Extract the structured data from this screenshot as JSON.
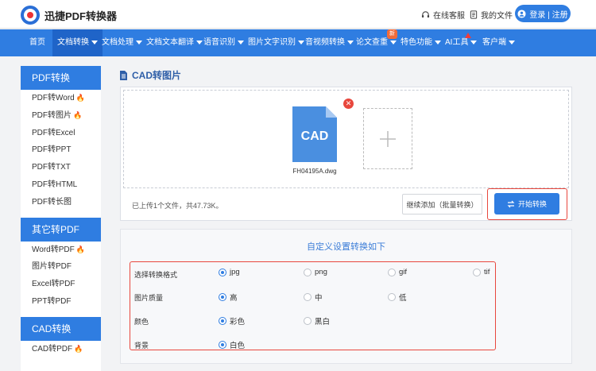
{
  "header": {
    "app_name": "迅捷PDF转换器",
    "support_label": "在线客服",
    "my_files_label": "我的文件",
    "login_label": "登录 | 注册"
  },
  "nav": {
    "items": [
      {
        "label": "首页"
      },
      {
        "label": "文档转换"
      },
      {
        "label": "文档处理"
      },
      {
        "label": "文档文本翻译"
      },
      {
        "label": "语音识别"
      },
      {
        "label": "图片文字识别"
      },
      {
        "label": "音视频转换"
      },
      {
        "label": "论文查重"
      },
      {
        "label": "特色功能"
      },
      {
        "label": "AI工具"
      },
      {
        "label": "客户端"
      }
    ],
    "new_badge": "新",
    "active_index": 1
  },
  "sidebar": {
    "sections": [
      {
        "title": "PDF转换",
        "items": [
          {
            "label": "PDF转Word",
            "hot": true
          },
          {
            "label": "PDF转图片",
            "hot": true
          },
          {
            "label": "PDF转Excel",
            "hot": false
          },
          {
            "label": "PDF转PPT",
            "hot": false
          },
          {
            "label": "PDF转TXT",
            "hot": false
          },
          {
            "label": "PDF转HTML",
            "hot": false
          },
          {
            "label": "PDF转长图",
            "hot": false
          }
        ]
      },
      {
        "title": "其它转PDF",
        "items": [
          {
            "label": "Word转PDF",
            "hot": true
          },
          {
            "label": "图片转PDF",
            "hot": false
          },
          {
            "label": "Excel转PDF",
            "hot": false
          },
          {
            "label": "PPT转PDF",
            "hot": false
          }
        ]
      },
      {
        "title": "CAD转换",
        "items": [
          {
            "label": "CAD转PDF",
            "hot": true
          }
        ]
      }
    ]
  },
  "main": {
    "title": "CAD转图片",
    "file": {
      "icon_text": "CAD",
      "name": "FH04195A.dwg"
    },
    "upload_status": "已上传1个文件，共47.73K。",
    "continue_label": "继续添加（批量转换）",
    "start_label": "开始转换"
  },
  "settings": {
    "title": "自定义设置转换如下",
    "rows": [
      {
        "label": "选择转换格式",
        "options": [
          "jpg",
          "png",
          "gif",
          "tif"
        ],
        "selected": "jpg"
      },
      {
        "label": "图片质量",
        "options": [
          "高",
          "中",
          "低"
        ],
        "selected": "高"
      },
      {
        "label": "颜色",
        "options": [
          "彩色",
          "黑白"
        ],
        "selected": "彩色"
      },
      {
        "label": "背景",
        "options": [
          "白色"
        ],
        "selected": "白色"
      }
    ]
  },
  "colors": {
    "brand_blue": "#2f7de1",
    "highlight_red": "#e8473d",
    "hot_orange": "#f26b3a",
    "cad_file_blue": "#4a8fe0"
  }
}
